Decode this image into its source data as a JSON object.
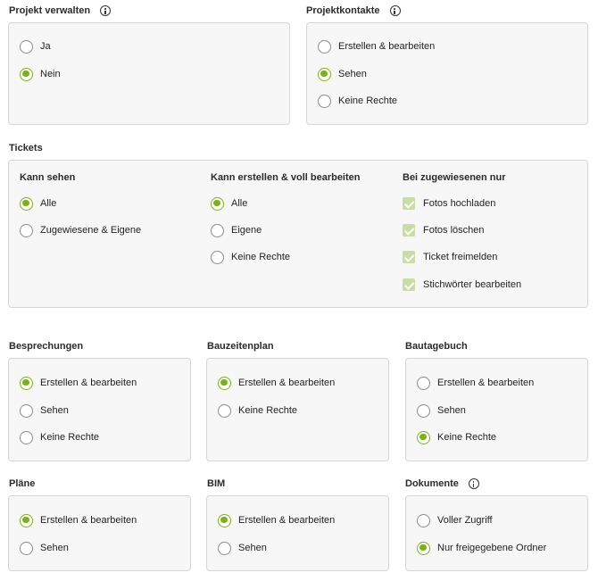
{
  "projekt_verwalten": {
    "label": "Projekt verwalten",
    "options": [
      {
        "label": "Ja",
        "selected": false
      },
      {
        "label": "Nein",
        "selected": true
      }
    ]
  },
  "projektkontakte": {
    "label": "Projektkontakte",
    "options": [
      {
        "label": "Erstellen & bearbeiten",
        "selected": false
      },
      {
        "label": "Sehen",
        "selected": true
      },
      {
        "label": "Keine Rechte",
        "selected": false
      }
    ]
  },
  "tickets": {
    "label": "Tickets",
    "kann_sehen": {
      "title": "Kann sehen",
      "options": [
        {
          "label": "Alle",
          "selected": true
        },
        {
          "label": "Zugewiesene & Eigene",
          "selected": false
        }
      ]
    },
    "kann_erstellen": {
      "title": "Kann erstellen & voll bearbeiten",
      "options": [
        {
          "label": "Alle",
          "selected": true
        },
        {
          "label": "Eigene",
          "selected": false
        },
        {
          "label": "Keine Rechte",
          "selected": false
        }
      ]
    },
    "zugewiesen": {
      "title": "Bei zugewiesenen nur",
      "options": [
        {
          "label": "Fotos hochladen",
          "checked": true
        },
        {
          "label": "Fotos löschen",
          "checked": true
        },
        {
          "label": "Ticket freimelden",
          "checked": true
        },
        {
          "label": "Stichwörter bearbeiten",
          "checked": true
        }
      ]
    }
  },
  "besprechungen": {
    "label": "Besprechungen",
    "options": [
      {
        "label": "Erstellen & bearbeiten",
        "selected": true
      },
      {
        "label": "Sehen",
        "selected": false
      },
      {
        "label": "Keine Rechte",
        "selected": false
      }
    ]
  },
  "bauzeitenplan": {
    "label": "Bauzeitenplan",
    "options": [
      {
        "label": "Erstellen & bearbeiten",
        "selected": true
      },
      {
        "label": "Keine Rechte",
        "selected": false
      }
    ]
  },
  "bautagebuch": {
    "label": "Bautagebuch",
    "options": [
      {
        "label": "Erstellen & bearbeiten",
        "selected": false
      },
      {
        "label": "Sehen",
        "selected": false
      },
      {
        "label": "Keine Rechte",
        "selected": true
      }
    ]
  },
  "plaene": {
    "label": "Pläne",
    "options": [
      {
        "label": "Erstellen & bearbeiten",
        "selected": true
      },
      {
        "label": "Sehen",
        "selected": false
      }
    ]
  },
  "bim": {
    "label": "BIM",
    "options": [
      {
        "label": "Erstellen & bearbeiten",
        "selected": true
      },
      {
        "label": "Sehen",
        "selected": false
      }
    ]
  },
  "dokumente": {
    "label": "Dokumente",
    "options": [
      {
        "label": "Voller Zugriff",
        "selected": false
      },
      {
        "label": "Nur freigegebene Ordner",
        "selected": true
      }
    ]
  },
  "colors": {
    "accent": "#7ab317",
    "checkbox_fill": "#c9dda4",
    "card_background": "#f7f7f7",
    "card_border": "#d6d6d6"
  },
  "icons": {
    "info": "info-icon",
    "radio": "radio-icon",
    "checkbox": "checkbox-icon"
  }
}
